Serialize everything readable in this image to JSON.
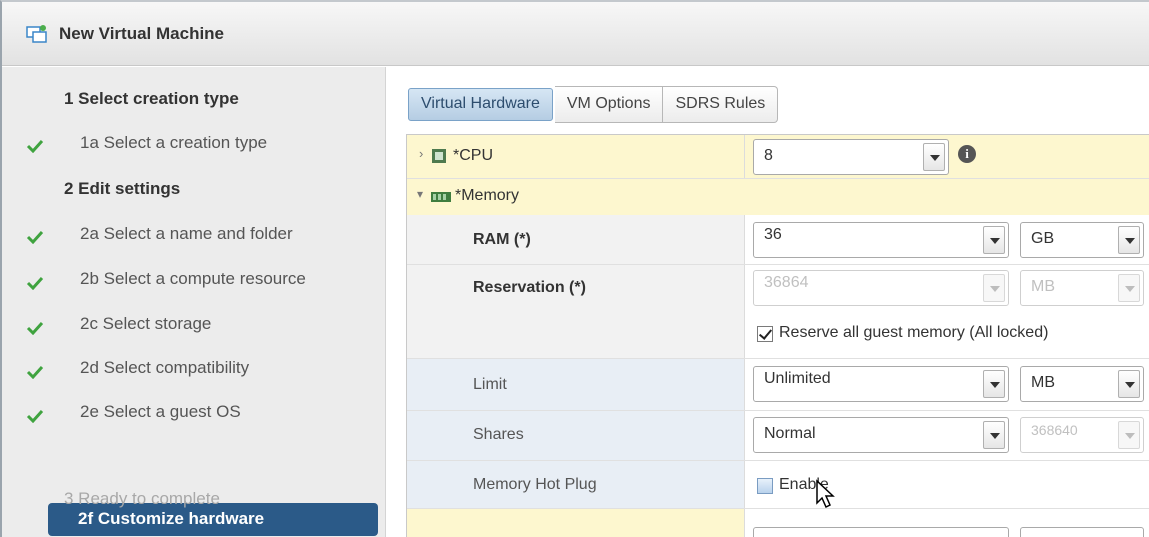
{
  "window": {
    "title": "New Virtual Machine",
    "icon": "new-vm-icon"
  },
  "steps": {
    "s1": {
      "label": "1  Select creation type"
    },
    "s1a": {
      "label": "1a  Select a creation type",
      "done": true
    },
    "s2": {
      "label": "2  Edit settings"
    },
    "s2a": {
      "label": "2a  Select a name and folder",
      "done": true
    },
    "s2b": {
      "label": "2b  Select a compute resource",
      "done": true
    },
    "s2c": {
      "label": "2c  Select storage",
      "done": true
    },
    "s2d": {
      "label": "2d  Select compatibility",
      "done": true
    },
    "s2e": {
      "label": "2e  Select a guest OS",
      "done": true
    },
    "s2f": {
      "label": "2f  Customize hardware",
      "selected": true
    },
    "s3": {
      "label": "3  Ready to complete",
      "disabled": true
    }
  },
  "tabs": [
    "Virtual Hardware",
    "VM Options",
    "SDRS Rules"
  ],
  "hardware": {
    "cpu": {
      "label": "*CPU",
      "value": "8"
    },
    "memory": {
      "label": "*Memory"
    },
    "ram": {
      "label": "RAM (*)",
      "value": "36",
      "unit": "GB"
    },
    "reservation": {
      "label": "Reservation (*)",
      "value": "36864",
      "unit": "MB",
      "reserve_all_label": "Reserve all guest memory (All locked)",
      "reserve_all_checked": true
    },
    "limit": {
      "label": "Limit",
      "value": "Unlimited",
      "unit": "MB"
    },
    "shares": {
      "label": "Shares",
      "value": "Normal",
      "amount": "368640"
    },
    "hotplug": {
      "label": "Memory Hot Plug",
      "enable_label": "Enable",
      "checked": false
    }
  },
  "colors": {
    "selected_step": "#2b5a88",
    "check_green": "#3fa33f",
    "cpu_row": "#fdf7cf",
    "memory_sub_row": "#e8eef5"
  }
}
